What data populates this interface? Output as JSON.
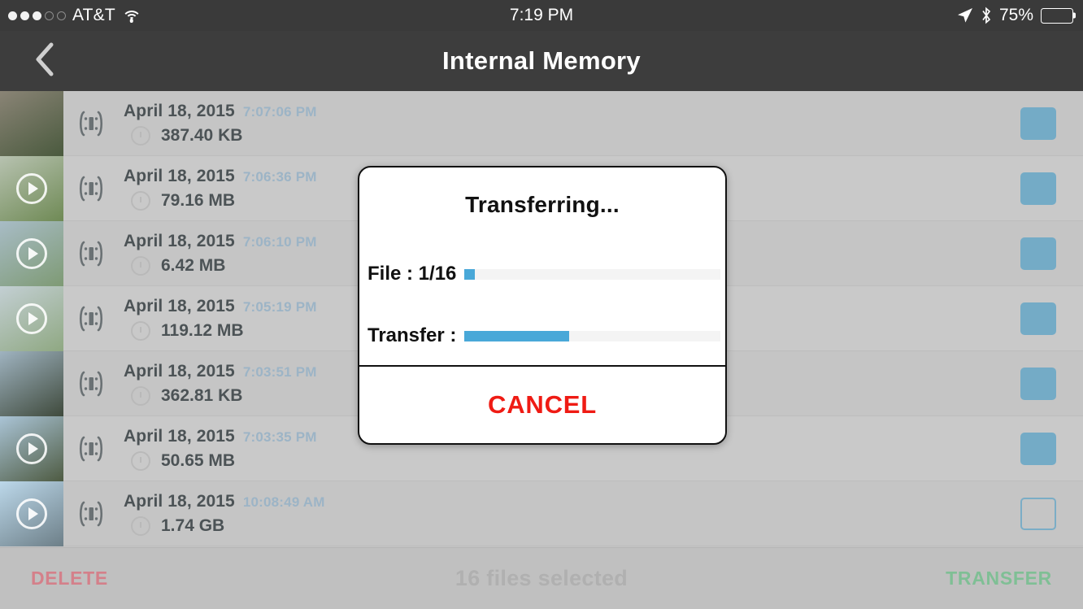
{
  "statusbar": {
    "carrier": "AT&T",
    "time": "7:19 PM",
    "battery_percent": "75%",
    "battery_level": 75,
    "signal_dots_filled": 3,
    "signal_dots_total": 5,
    "icons": [
      "wifi-icon",
      "location-arrow-icon",
      "bluetooth-icon",
      "battery-icon"
    ]
  },
  "navbar": {
    "title": "Internal Memory",
    "back_icon": "chevron-left-icon"
  },
  "list": {
    "rows": [
      {
        "date": "April 18, 2015",
        "time": "7:07:06 PM",
        "size": "387.40 KB",
        "is_video": false,
        "checked": true,
        "thumb_from": "#8a8476",
        "thumb_to": "#4a5a3e"
      },
      {
        "date": "April 18, 2015",
        "time": "7:06:36 PM",
        "size": "79.16 MB",
        "is_video": true,
        "checked": true,
        "thumb_from": "#b7c2b0",
        "thumb_to": "#6f8a55"
      },
      {
        "date": "April 18, 2015",
        "time": "7:06:10 PM",
        "size": "6.42 MB",
        "is_video": true,
        "checked": true,
        "thumb_from": "#a8bcc6",
        "thumb_to": "#7e9a74"
      },
      {
        "date": "April 18, 2015",
        "time": "7:05:19 PM",
        "size": "119.12 MB",
        "is_video": true,
        "checked": true,
        "thumb_from": "#c3cfd3",
        "thumb_to": "#8fa882"
      },
      {
        "date": "April 18, 2015",
        "time": "7:03:51 PM",
        "size": "362.81 KB",
        "is_video": false,
        "checked": true,
        "thumb_from": "#9fb3c0",
        "thumb_to": "#3f4a3c"
      },
      {
        "date": "April 18, 2015",
        "time": "7:03:35 PM",
        "size": "50.65 MB",
        "is_video": true,
        "checked": true,
        "thumb_from": "#aac4d6",
        "thumb_to": "#4e5b42"
      },
      {
        "date": "April 18, 2015",
        "time": "10:08:49 AM",
        "size": "1.74 GB",
        "is_video": true,
        "checked": false,
        "thumb_from": "#bcd8ea",
        "thumb_to": "#6d7f88"
      }
    ],
    "media_icon": "media-bracket-icon",
    "clock_icon": "clock-icon",
    "play_icon": "play-circle-icon",
    "checkbox_icon": "checkbox-icon"
  },
  "bottombar": {
    "delete_label": "DELETE",
    "selected_label": "16 files selected",
    "transfer_label": "TRANSFER",
    "delete_color": "#d4808a",
    "transfer_color": "#7fbf95"
  },
  "dialog": {
    "title": "Transferring...",
    "file_label": "File : 1/16",
    "file_progress_percent": 4,
    "transfer_label": "Transfer :",
    "transfer_progress_percent": 41,
    "cancel_label": "CANCEL",
    "cancel_color": "#ef1b14",
    "progress_color": "#49a8d8"
  }
}
